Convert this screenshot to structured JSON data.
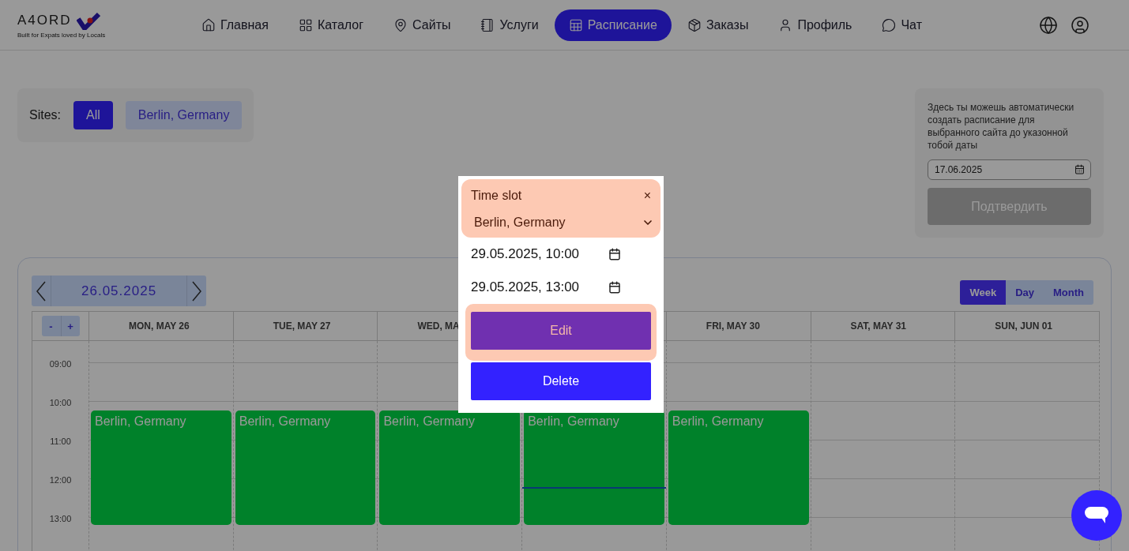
{
  "brand": {
    "name": "A4ORD",
    "tagline": "Built for Expats loved by Locals"
  },
  "nav": [
    {
      "label": "Главная",
      "selected": false
    },
    {
      "label": "Каталог",
      "selected": false
    },
    {
      "label": "Сайты",
      "selected": false
    },
    {
      "label": "Услуги",
      "selected": false
    },
    {
      "label": "Расписание",
      "selected": true
    },
    {
      "label": "Заказы",
      "selected": false
    },
    {
      "label": "Профиль",
      "selected": false
    },
    {
      "label": "Чат",
      "selected": false
    }
  ],
  "sites_filter": {
    "label": "Sites:",
    "options": [
      {
        "label": "All",
        "selected": true
      },
      {
        "label": "Berlin, Germany",
        "selected": false
      }
    ]
  },
  "auto_schedule": {
    "text": "Здесь ты можешь автоматически создать расписание для выбранного сайта до указонной тобой даты",
    "date": "17.06.2025",
    "confirm": {
      "label": "Подтвердить",
      "disabled": true
    }
  },
  "calendar": {
    "date": "26.05.2025",
    "zoom": [
      "-",
      "+"
    ],
    "views": [
      {
        "label": "Week",
        "selected": true
      },
      {
        "label": "Day",
        "selected": false
      },
      {
        "label": "Month",
        "selected": false
      }
    ],
    "times": [
      "09:00",
      "10:00",
      "11:00",
      "12:00",
      "13:00"
    ],
    "days": [
      {
        "label": "MON, MAY 26",
        "events": [
          {
            "title": "Berlin, Germany"
          }
        ]
      },
      {
        "label": "TUE, MAY 27",
        "events": [
          {
            "title": "Berlin, Germany"
          }
        ]
      },
      {
        "label": "WED, MA",
        "events": [
          {
            "title": "Berlin, Germany"
          }
        ]
      },
      {
        "events": [
          {
            "title": "Berlin, Germany"
          }
        ],
        "current_time_line": true
      },
      {
        "label": "FRI, MAY 30",
        "events": [
          {
            "title": "Berlin, Germany"
          }
        ]
      },
      {
        "label": "SAT, MAY 31"
      },
      {
        "label": "SUN, JUN 01"
      }
    ]
  },
  "modal": {
    "title": "Time slot",
    "close": "×",
    "site": "Berlin, Germany",
    "start": "29.05.2025, 10:00",
    "end": "29.05.2025, 13:00",
    "edit": "Edit",
    "delete": "Delete"
  }
}
